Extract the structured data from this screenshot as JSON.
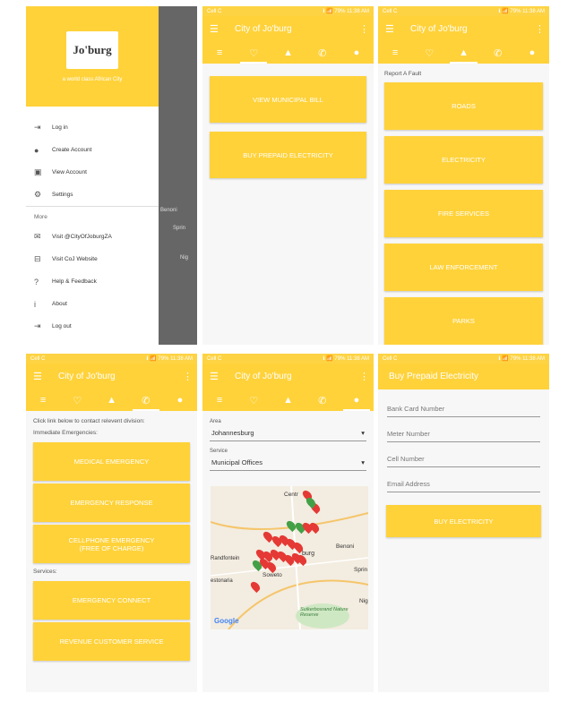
{
  "status": {
    "carrier": "Cell C",
    "right": "ℹ 📶 79% 11:38 AM"
  },
  "drawer": {
    "logo_text": "Jo'burg",
    "tagline": "a world class African City",
    "items": [
      {
        "label": "Log in",
        "icon": "login-icon",
        "glyph": "⇥"
      },
      {
        "label": "Create Account",
        "icon": "account-icon",
        "glyph": "●"
      },
      {
        "label": "View Account",
        "icon": "person-box-icon",
        "glyph": "▣"
      },
      {
        "label": "Settings",
        "icon": "gear-icon",
        "glyph": "⚙"
      }
    ],
    "more_label": "More",
    "more_items": [
      {
        "label": "Visit @CityOfJoburgZA",
        "icon": "twitter-icon",
        "glyph": "✉"
      },
      {
        "label": "Visit CoJ Website",
        "icon": "web-icon",
        "glyph": "⊟"
      },
      {
        "label": "Help & Feedback",
        "icon": "help-icon",
        "glyph": "?"
      },
      {
        "label": "About",
        "icon": "info-icon",
        "glyph": "i"
      },
      {
        "label": "Log out",
        "icon": "logout-icon",
        "glyph": "⇥"
      }
    ]
  },
  "shade_labels": [
    "Benoni",
    "Sprin",
    "Nig"
  ],
  "app": {
    "title": "City of Jo'burg"
  },
  "tabs": [
    {
      "name": "tab-list",
      "glyph": "≡"
    },
    {
      "name": "tab-idea",
      "glyph": "♡"
    },
    {
      "name": "tab-report",
      "glyph": "▲"
    },
    {
      "name": "tab-call",
      "glyph": "✆"
    },
    {
      "name": "tab-location",
      "glyph": "●"
    }
  ],
  "screen2": {
    "buttons": [
      "VIEW MUNICIPAL BILL",
      "BUY PREPAID ELECTRICITY"
    ]
  },
  "screen3": {
    "heading": "Report A Fault",
    "buttons": [
      "ROADS",
      "ELECTRICITY",
      "FIRE SERVICES",
      "LAW ENFORCEMENT",
      "PARKS"
    ]
  },
  "screen4": {
    "intro": "Click link below to contact relevent division:",
    "immediate": "Immediate Emergencies:",
    "emergency_buttons": [
      "MEDICAL EMERGENCY",
      "EMERGENCY RESPONSE",
      "CELLPHONE EMERGENCY\n(FREE OF CHARGE)"
    ],
    "services": "Services:",
    "service_buttons": [
      "EMERGENCY CONNECT",
      "REVENUE CUSTOMER SERVICE"
    ]
  },
  "screen5": {
    "area_label": "Area",
    "area_value": "Johannesburg",
    "service_label": "Service",
    "service_value": "Municipal Offices",
    "map_labels": [
      "Centr",
      "burg",
      "Benoni",
      "Randfontein",
      "Soweto",
      "estonaria",
      "Sprin",
      "Nig",
      "Suikerbosrand Nature Reserve",
      "Google"
    ]
  },
  "screen6": {
    "title": "Buy Prepaid Electricity",
    "fields": [
      "Bank Card Number",
      "Meter Number",
      "Cell Number",
      "Email Address"
    ],
    "button": "BUY ELECTRICITY"
  },
  "colors": {
    "accent": "#ffd23a",
    "pin_red": "#e53935",
    "pin_green": "#43a047"
  }
}
